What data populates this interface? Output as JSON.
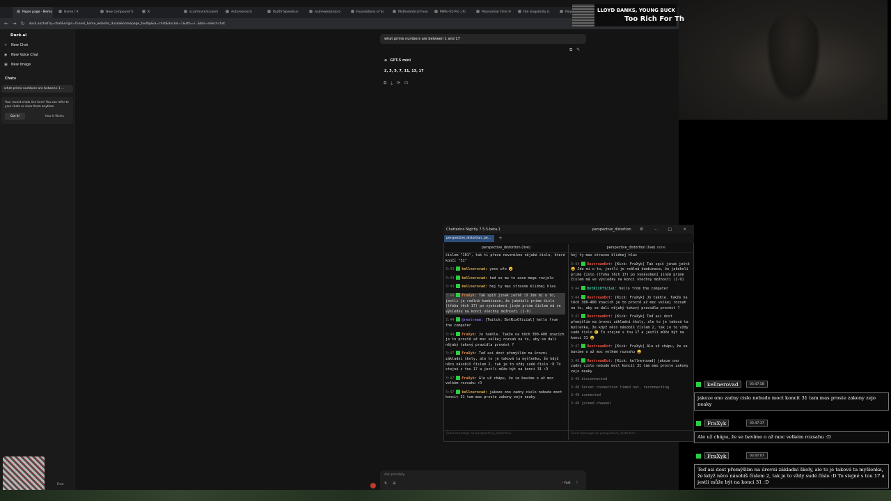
{
  "browser": {
    "tabs": [
      "Paper page - Nemo",
      "Home / X",
      "New compound ti",
      "X",
      "scummvm/scumm",
      "Autoresearch",
      "Rozšíř Speedrun",
      "andrewleizin/pro",
      "Foundations of Sc",
      "Mathematical Foun",
      "MiMo-V2-Pro | Xi",
      "Polynomial Time H",
      "the singularity is",
      "Polynomial"
    ],
    "url": "duck.ai/chat?q=chat&origin=funnel_home_website_ducka&homepage_tooltip&ia=chat&duckai=1&atb=v...&bkl=select-chat"
  },
  "sidebar": {
    "brand": "Duck.ai",
    "items": [
      {
        "label": "New Chat",
        "icon": "plus-icon"
      },
      {
        "label": "New Voice Chat",
        "icon": "mic-icon"
      },
      {
        "label": "New Image",
        "icon": "image-icon"
      }
    ],
    "chats_heading": "Chats",
    "recent_chat": "what prime numbers are between 1 ...",
    "card_text": "Your recent chats live here! You can refer to your chats or clear them anytime.",
    "card_ok": "Got It!",
    "card_how": "How It Works",
    "plan": "Free"
  },
  "chat": {
    "user_message": "what prime numbers are between 1 and 17",
    "model": "GPT-5 mini",
    "answer": "2, 3, 5, 7, 11, 13, 17",
    "input_placeholder": "Ask privately",
    "mode": "Fast"
  },
  "now_playing": {
    "artist": "LLOYD BANKS, YOUNG BUCK",
    "title": "Too Rich For Th"
  },
  "chatterino": {
    "title": "Chatterino Nightly 7.5.5-beta.1",
    "user": "perspective_distortion",
    "tab": "perspective_distortion, pe...",
    "left_header": "perspective_distortion (live)",
    "right_header": "perspective_distortion (live)",
    "right_mode": "none",
    "send_placeholder": "Send message as perspective_distortion...",
    "left_messages": [
      {
        "text": "číslem \"101\", tak ti přece nevznikne nějaké číslo, které končí \"31\""
      },
      {
        "ts": "3:43",
        "nick": "kellnerovad:",
        "color": "#d4a94b",
        "text": "yess ufo 😮"
      },
      {
        "ts": "3:43",
        "nick": "kellnerovad:",
        "color": "#d4a94b",
        "text": "ted se mu to zase mega rozjelo"
      },
      {
        "ts": "3:43",
        "nick": "kellnerovad:",
        "color": "#d4a94b",
        "text": "hej ty mas strasne klidnej hlas"
      },
      {
        "ts": "3:44",
        "nick": "FraXyk:",
        "color": "#e08a4a",
        "text": "Tak spíš jinak ještě :D Jde mi o to, jestli je reálná kombinace, že jakékoli prime číslo (třeba těch 17) po vynásobení jiným prime číslem má ve výsledku na konci všechny možnosti (1-9)",
        "hl": true
      },
      {
        "ts": "3:44",
        "nick": "@restream:",
        "color": "#7b6cd9",
        "text": "[Twitch: BotRixOficial] hello from the computer"
      },
      {
        "ts": "3:44",
        "nick": "FraXyk:",
        "color": "#e08a4a",
        "text": "Jo takhle. Takže na těch 300-400 znacích je to prostě až moc velkej rozsah na to, aby se dali nějaký takový pravidla provést ?"
      },
      {
        "ts": "3:47",
        "nick": "FraXyk:",
        "color": "#e08a4a",
        "text": "Teď asi dost přemýšlím na úrovni základní školy, ale to je taková ta myšlenka, že když něco násobíš číslem 2, tak je to vždy sudé číslo :D To stejné s tou 17 a jestli může být na konci 31 :D"
      },
      {
        "ts": "3:47",
        "nick": "FraXyk:",
        "color": "#e08a4a",
        "text": "Ale už chápu, že se bavíme o až moc velkém rozsahu :D"
      },
      {
        "ts": "3:47",
        "nick": "kellnerovad:",
        "color": "#d4a94b",
        "text": "jakoze ono zadny cislo nebude moct koncit 31 tam mas proste zakony zejo neaky"
      }
    ],
    "right_messages": [
      {
        "text": "hej ty mas strasne klidnej hlas"
      },
      {
        "ts": "3:44",
        "nick": "RestreamBot:",
        "color": "#e0503f",
        "text": "[Kick: FraXyk] Tak spíš jinak ještě 😀 Jde mi o to, jestli je reálná kombinace, že jakékoli prime číslo (třeba těch 17) po vynásobení jiným prime číslem má ve výsledku na konci všechny možnosti (1-9)"
      },
      {
        "ts": "3:44",
        "nick": "BotRixOficial:",
        "color": "#3ec1a0",
        "text": "hello from the computer"
      },
      {
        "ts": "3:44",
        "nick": "RestreamBot:",
        "color": "#e0503f",
        "text": "[Kick: FraXyk] Jo takhle. Takže na těch 300-400 znacích je to prostě až moc velkej rozsah na to, aby se dali nějaký takový pravidla provést ?"
      },
      {
        "ts": "3:47",
        "nick": "RestreamBot:",
        "color": "#e0503f",
        "text": "[Kick: FraXyk] Teď asi dost přemýšlím na úrovni základní školy, ale to je taková ta myšlenka, že když něco násobíš číslem 2, tak je to vždy sudé číslo 😀 To stejné s tou 17 a jestli může být na konci 31 😀"
      },
      {
        "ts": "3:47",
        "nick": "RestreamBot:",
        "color": "#e0503f",
        "text": "[Kick: FraXyk] Ale už chápu, že se bavíme o až moc velkém rozsahu 😀"
      },
      {
        "ts": "3:48",
        "nick": "RestreamBot:",
        "color": "#e0503f",
        "text": "[Kick: kellnerovad] jakoze ono zadny cislo nebude moct koncit 31 tam mas proste zakony zejo neaky"
      },
      {
        "ts": "3:48",
        "sys": "disconnected"
      },
      {
        "ts": "3:48",
        "sys": "Server connection timed out, reconnecting"
      },
      {
        "ts": "3:48",
        "sys": "connected"
      },
      {
        "ts": "3:48",
        "sys": "joined channel"
      }
    ]
  },
  "overlay_chat": [
    {
      "name": "kellnerovad",
      "time": "03:47:58",
      "text": "jakoze ono zadny cislo nebude moct koncit 31 tam mas proste zakony zejo neaky"
    },
    {
      "name": "FraXyk",
      "time": "03:47:37",
      "text": "Ale už chápu, že se bavíme o až moc velkém rozsahu :D"
    },
    {
      "name": "FraXyk",
      "time": "03:47:07",
      "text": "Teď asi dost přemýšlím na úrovni základní školy, ale to je taková ta myšlenka, že když něco násobíš číslem 2, tak je to vždy sudé číslo :D To stejné s tou 17 a jestli může být na konci 31 :D"
    }
  ]
}
